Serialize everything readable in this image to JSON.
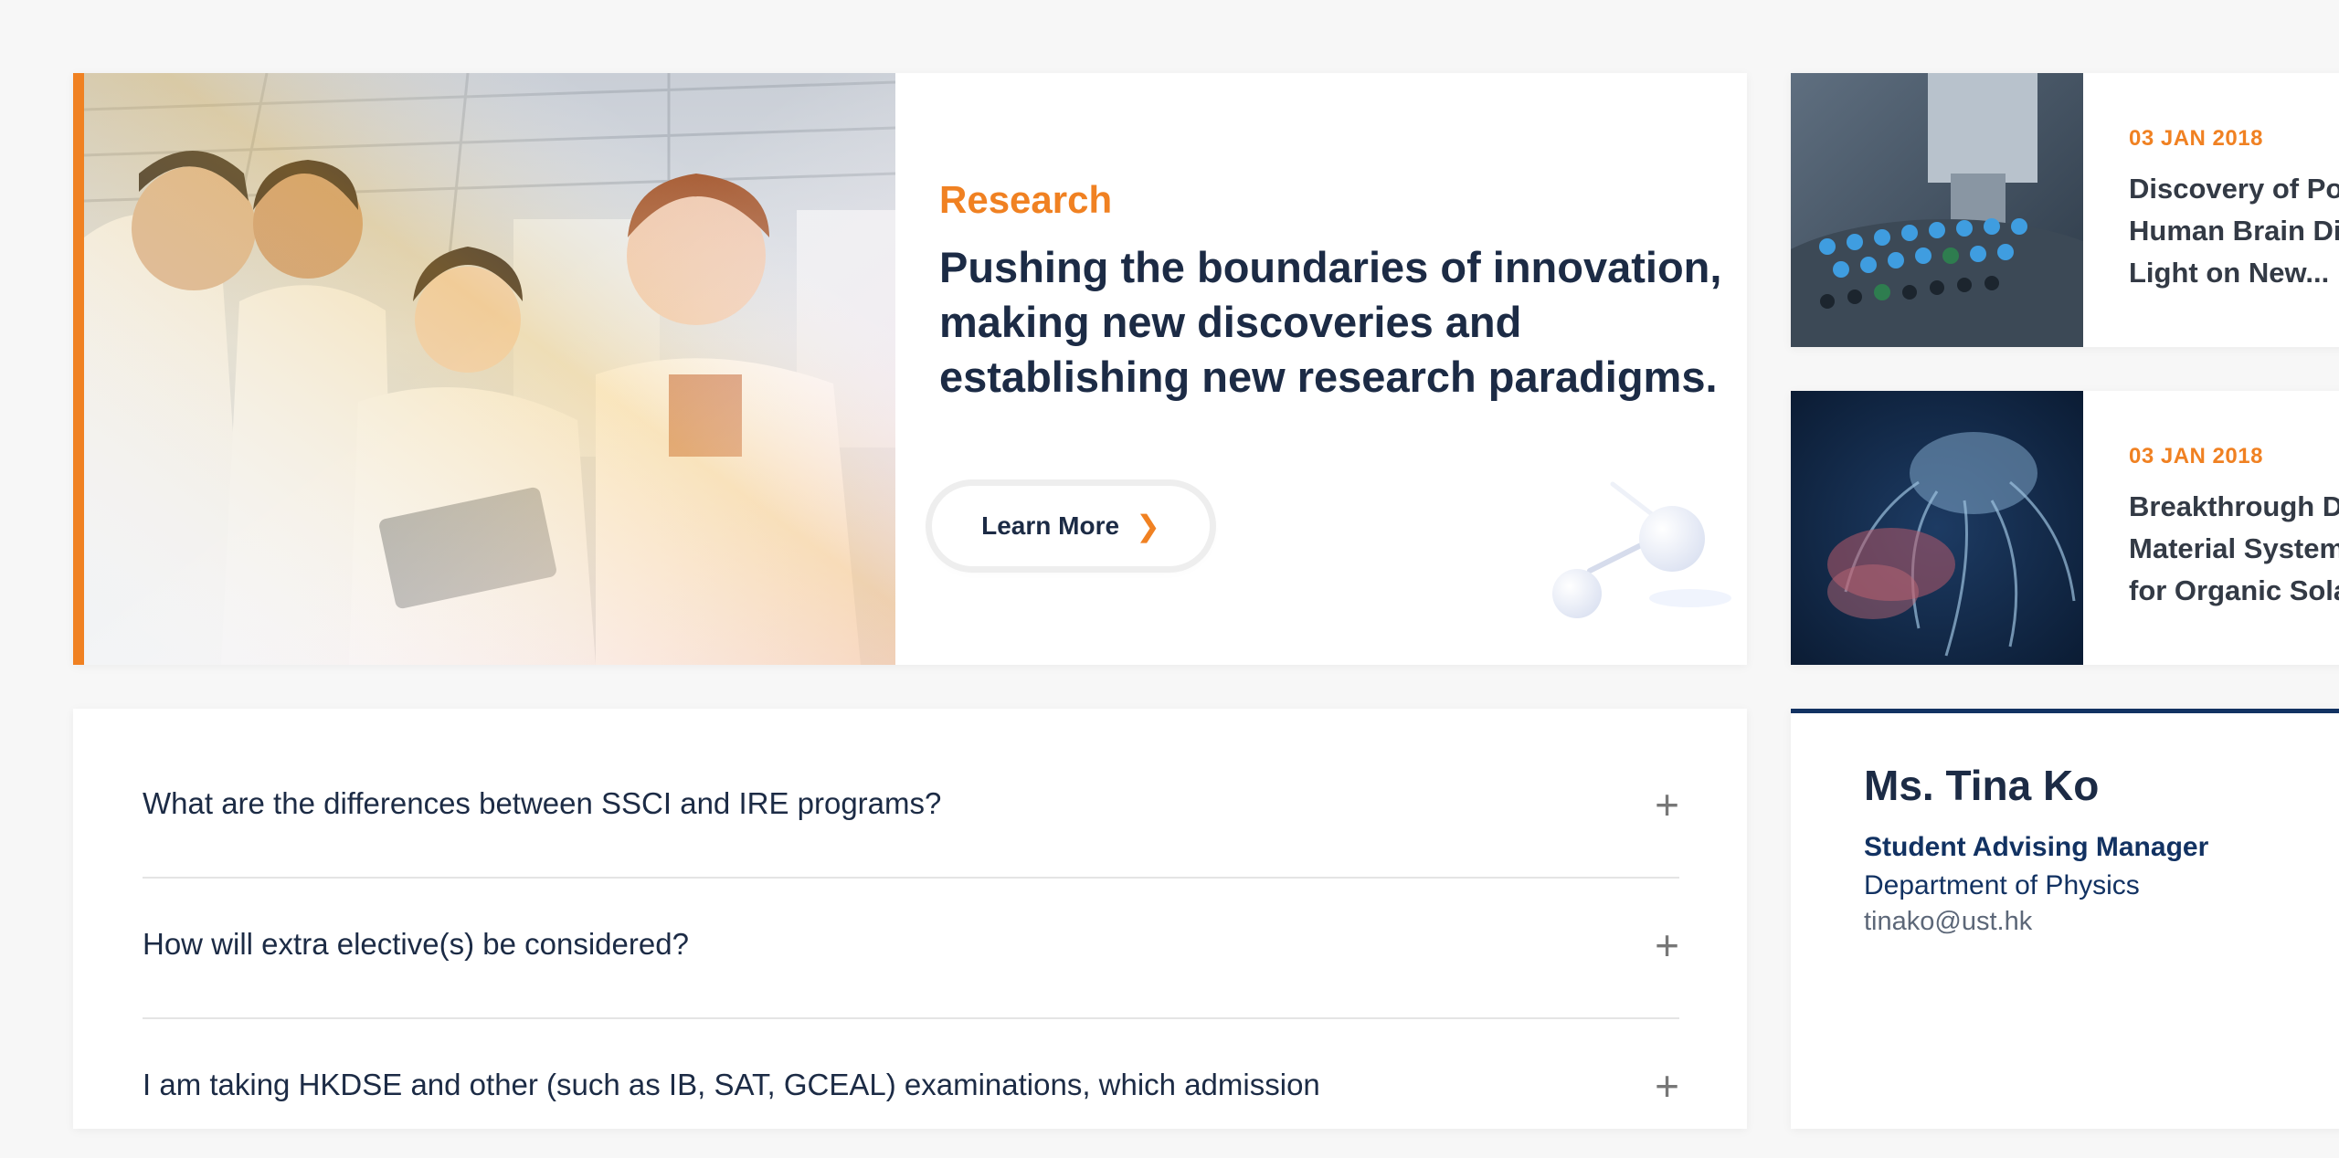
{
  "research": {
    "kicker": "Research",
    "title": "Pushing the boundaries of innovation, making new discoveries and establishing new research paradigms.",
    "button_label": "Learn More",
    "image_alt": "Students in lab coats looking at a tablet in a laboratory"
  },
  "news": [
    {
      "date": "03 JAN 2018",
      "title_lines": [
        "Discovery of Pos",
        "Human Brain Dis",
        "Light on New..."
      ],
      "image": "lab-samples"
    },
    {
      "date": "03 JAN 2018",
      "title_lines": [
        "Breakthrough Di",
        "Material System",
        "for Organic Sola"
      ],
      "image": "jellyfish"
    }
  ],
  "faq": {
    "items": [
      {
        "question": "What are the differences between SSCI and IRE programs?"
      },
      {
        "question": "How will extra elective(s) be considered?"
      },
      {
        "question": "I am taking HKDSE and other (such as IB, SAT, GCEAL) examinations, which admission"
      }
    ],
    "expand_icon": "plus-icon"
  },
  "contact": {
    "name": "Ms. Tina Ko",
    "role": "Student Advising Manager",
    "department": "Department of Physics",
    "email": "tinako@ust.hk"
  },
  "colors": {
    "accent": "#f08122",
    "navy": "#123262",
    "text": "#1c2b45",
    "background": "#f7f7f7"
  }
}
